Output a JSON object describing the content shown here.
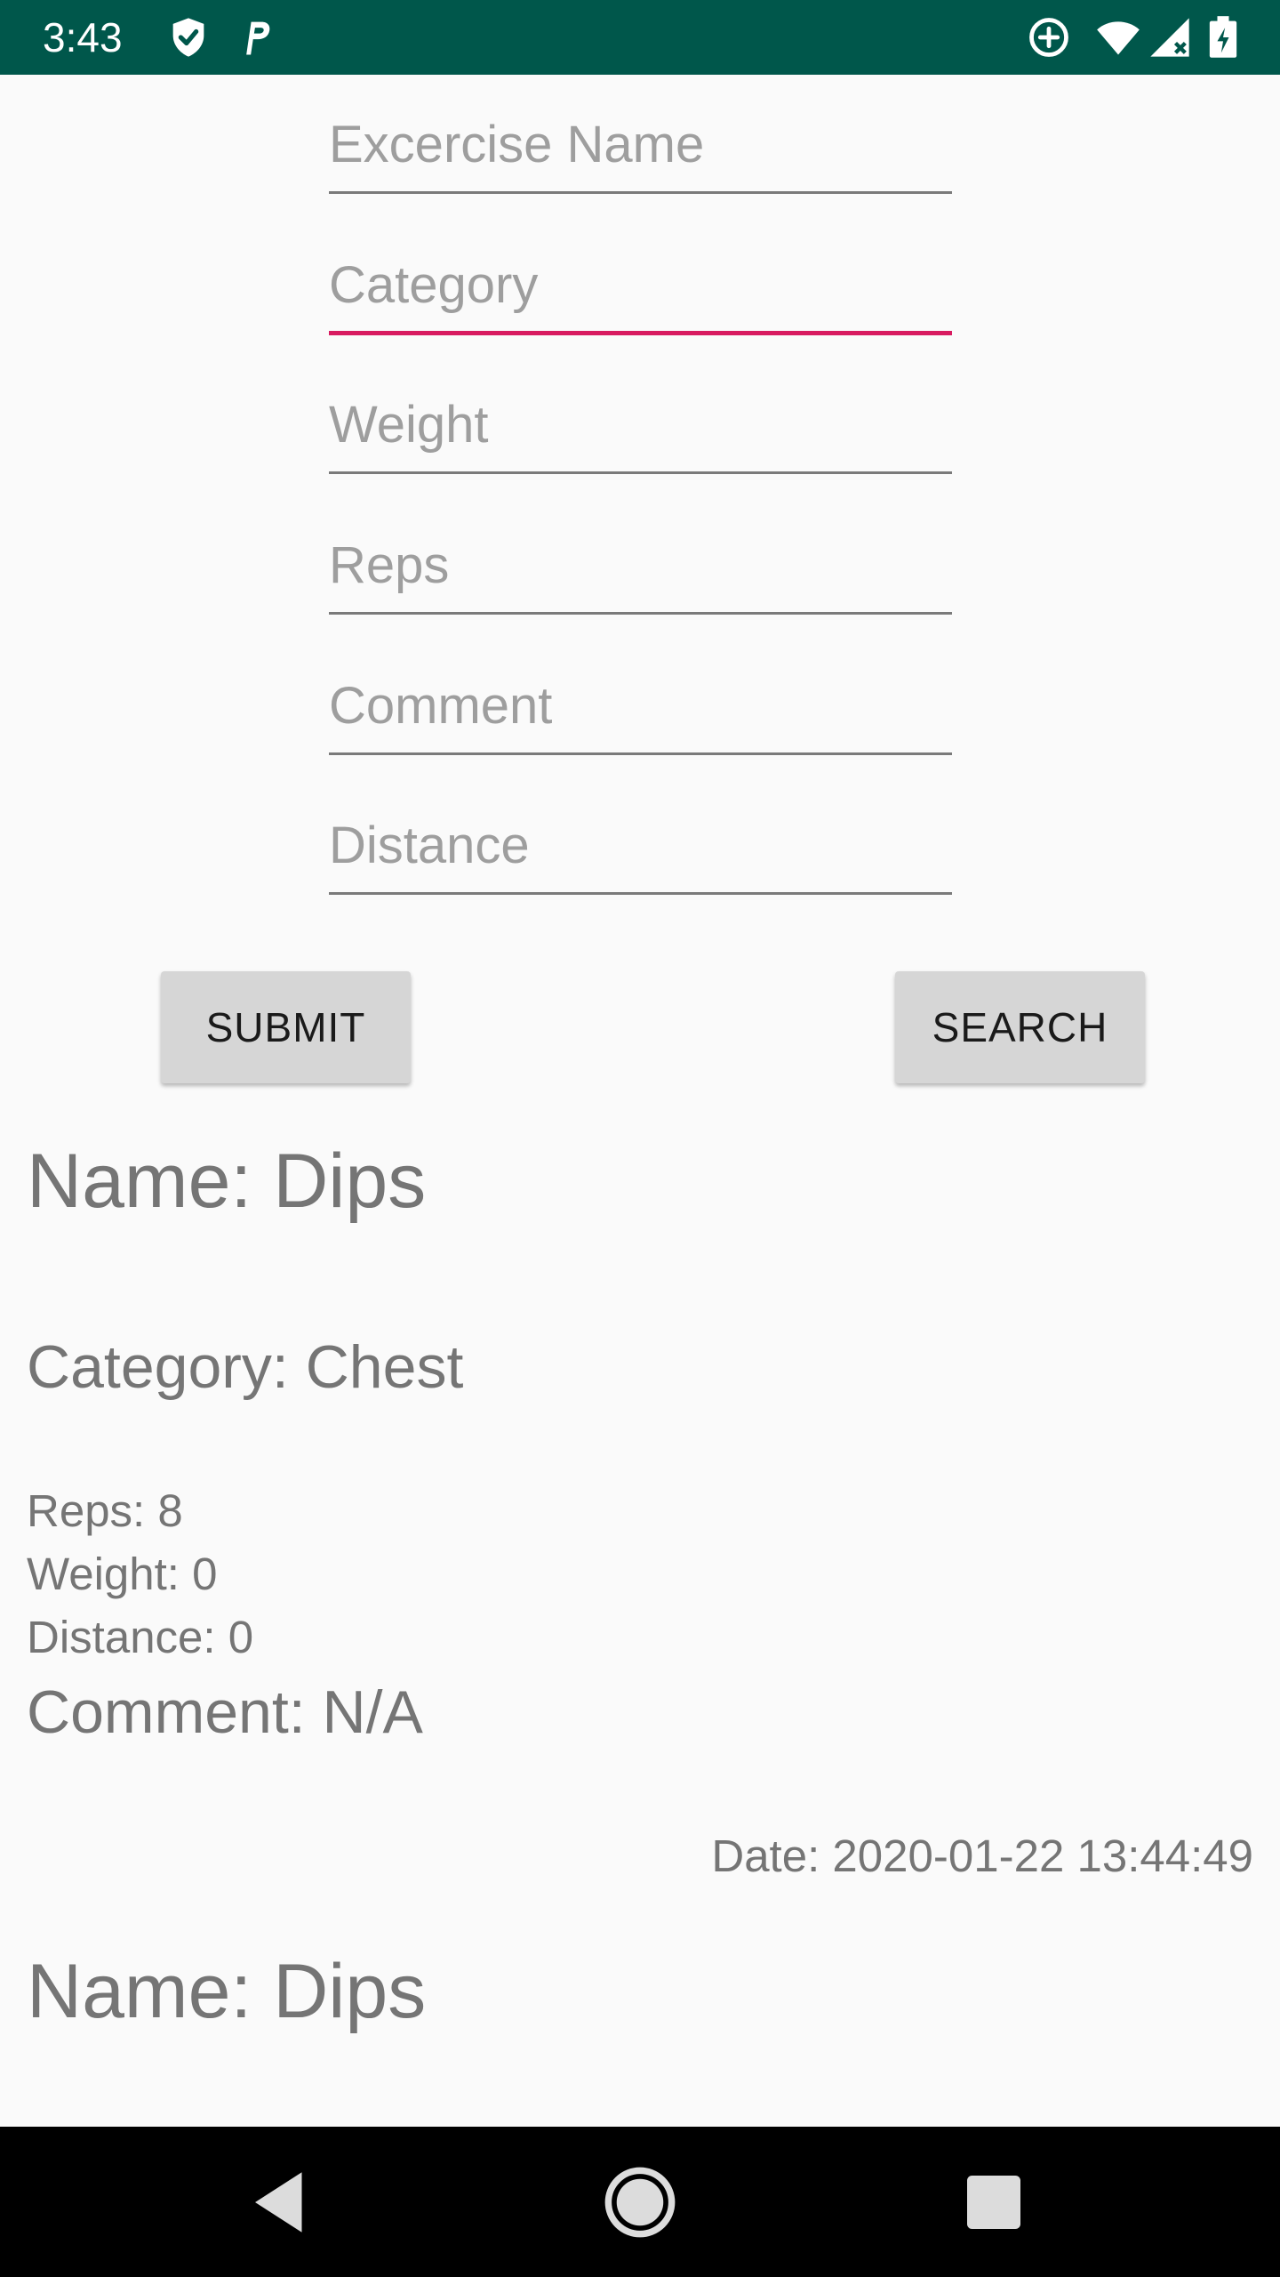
{
  "status_bar": {
    "time": "3:43",
    "icons": [
      "shield-check-icon",
      "parking-p-icon",
      "data-saver-icon",
      "wifi-icon",
      "cell-signal-icon",
      "battery-charging-icon"
    ],
    "background": "#00574b"
  },
  "form": {
    "fields": [
      {
        "placeholder": "Excercise Name",
        "value": ""
      },
      {
        "placeholder": "Category",
        "value": ""
      },
      {
        "placeholder": "Weight",
        "value": ""
      },
      {
        "placeholder": "Reps",
        "value": ""
      },
      {
        "placeholder": "Comment",
        "value": ""
      },
      {
        "placeholder": "Distance",
        "value": ""
      }
    ],
    "focused_field": "Category",
    "accent_color": "#d81b60"
  },
  "buttons": {
    "submit_label": "SUBMIT",
    "search_label": "SEARCH"
  },
  "results": [
    {
      "name": "Name: Dips",
      "category": "Category: Chest",
      "reps": "Reps: 8",
      "weight": "Weight: 0",
      "distance": "Distance: 0",
      "comment": "Comment: N/A",
      "date": "Date: 2020-01-22 13:44:49"
    },
    {
      "name": "Name: Dips"
    }
  ],
  "nav_bar": {
    "icons": [
      "back-triangle-icon",
      "home-circle-icon",
      "recents-square-icon"
    ]
  }
}
